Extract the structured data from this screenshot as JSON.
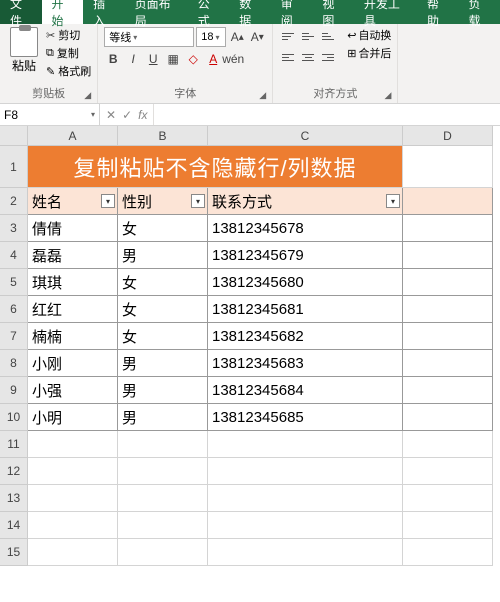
{
  "tabs": {
    "file": "文件",
    "home": "开始",
    "insert": "插入",
    "layout": "页面布局",
    "formulas": "公式",
    "data": "数据",
    "review": "审阅",
    "view": "视图",
    "dev": "开发工具",
    "help": "帮助",
    "extra": "负载"
  },
  "ribbon": {
    "clipboard": {
      "paste": "粘贴",
      "cut": "剪切",
      "copy": "复制",
      "format_painter": "格式刷",
      "group": "剪贴板"
    },
    "font": {
      "name": "等线",
      "size": "18",
      "group": "字体",
      "wen": "wén"
    },
    "align": {
      "wrap": "自动换",
      "merge": "合并后",
      "group": "对齐方式"
    }
  },
  "namebox": "F8",
  "fx": "fx",
  "columns": [
    "A",
    "B",
    "C",
    "D"
  ],
  "row_nums": [
    "1",
    "2",
    "3",
    "4",
    "5",
    "6",
    "7",
    "8",
    "9",
    "10",
    "11",
    "12",
    "13",
    "14",
    "15"
  ],
  "sheet": {
    "title": "复制粘贴不含隐藏行/列数据",
    "headers": {
      "name": "姓名",
      "gender": "性别",
      "contact": "联系方式"
    },
    "rows": [
      {
        "name": "倩倩",
        "gender": "女",
        "contact": "13812345678"
      },
      {
        "name": "磊磊",
        "gender": "男",
        "contact": "13812345679"
      },
      {
        "name": "琪琪",
        "gender": "女",
        "contact": "13812345680"
      },
      {
        "name": "红红",
        "gender": "女",
        "contact": "13812345681"
      },
      {
        "name": "楠楠",
        "gender": "女",
        "contact": "13812345682"
      },
      {
        "name": "小刚",
        "gender": "男",
        "contact": "13812345683"
      },
      {
        "name": "小强",
        "gender": "男",
        "contact": "13812345684"
      },
      {
        "name": "小明",
        "gender": "男",
        "contact": "13812345685"
      }
    ]
  }
}
